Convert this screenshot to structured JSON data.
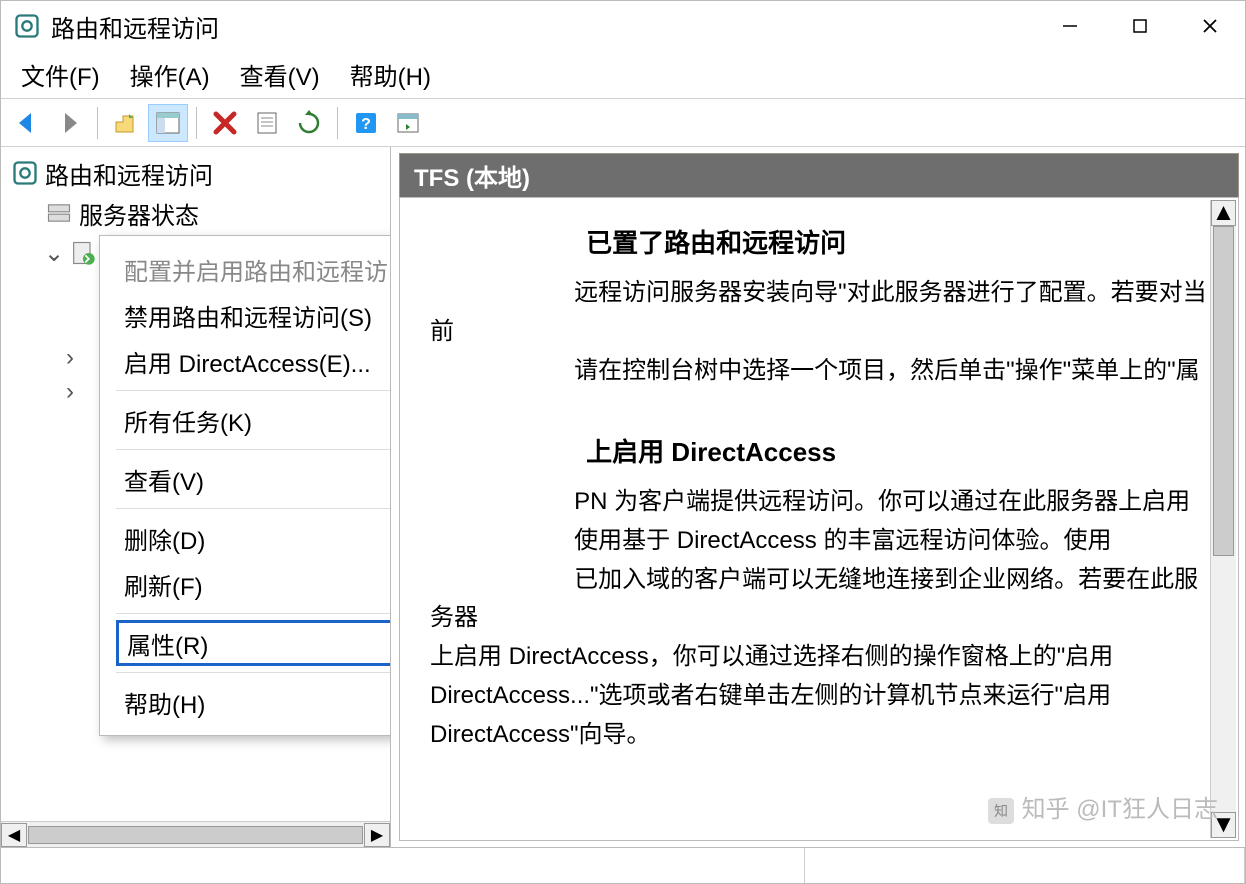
{
  "window": {
    "title": "路由和远程访问"
  },
  "menubar": {
    "file": "文件(F)",
    "action": "操作(A)",
    "view": "查看(V)",
    "help": "帮助(H)"
  },
  "tree": {
    "root": "路由和远程访问",
    "status": "服务器状态",
    "server": "TFS (本地)"
  },
  "context_menu": {
    "configure": "配置并启用路由和远程访问(C)",
    "disable": "禁用路由和远程访问(S)",
    "enable_da": "启用 DirectAccess(E)...",
    "all_tasks": "所有任务(K)",
    "view": "查看(V)",
    "delete": "删除(D)",
    "refresh": "刷新(F)",
    "properties": "属性(R)",
    "help": "帮助(H)"
  },
  "content": {
    "header": "TFS (本地)",
    "h1_suffix": "已置了路由和远程访问",
    "p1a": "远程访问服务器安装向导\"对此服务器进行了配置。若要对当前",
    "p1b": "请在控制台树中选择一个项目，然后单击\"操作\"菜单上的\"属",
    "h2_prefix": "上启用 DirectAccess",
    "p2a": "PN 为客户端提供远程访问。你可以通过在此服务器上启用",
    "p2b": "使用基于 DirectAccess 的丰富远程访问体验。使用",
    "p2c": "已加入域的客户端可以无缝地连接到企业网络。若要在此服务器",
    "p2d": "上启用 DirectAccess，你可以通过选择右侧的操作窗格上的\"启用 DirectAccess...\"选项或者右键单击左侧的计算机节点来运行\"启用 DirectAccess\"向导。"
  },
  "watermark": "知乎 @IT狂人日志"
}
